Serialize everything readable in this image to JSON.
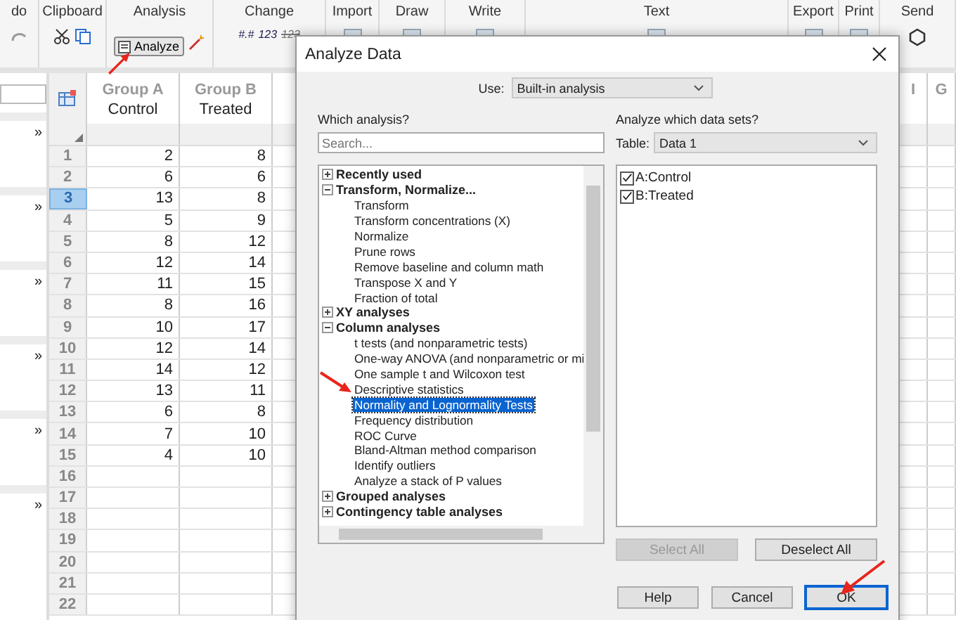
{
  "ribbon": {
    "groups": [
      {
        "label": "do",
        "kind": "undo"
      },
      {
        "label": "Clipboard",
        "kind": "clipboard"
      },
      {
        "label": "Analysis",
        "kind": "analysis"
      },
      {
        "label": "Change",
        "kind": "change"
      },
      {
        "label": "Import",
        "kind": "import"
      },
      {
        "label": "Draw",
        "kind": "draw"
      },
      {
        "label": "Write",
        "kind": "write"
      },
      {
        "label": "Text",
        "kind": "text"
      },
      {
        "label": "Export",
        "kind": "export"
      },
      {
        "label": "Print",
        "kind": "print"
      },
      {
        "label": "Send",
        "kind": "send"
      }
    ],
    "analyze_button": "Analyze",
    "change_glyphs": [
      {
        "text": "#.#",
        "struck": false
      },
      {
        "text": "123",
        "struck": false
      },
      {
        "text": "123",
        "struck": true
      }
    ]
  },
  "navigator": {
    "expanders": [
      "»",
      "»",
      "»",
      "»",
      "»",
      "»"
    ]
  },
  "sheet": {
    "columns": [
      {
        "title": "Group A",
        "subtitle": "Control"
      },
      {
        "title": "Group B",
        "subtitle": "Treated"
      }
    ],
    "far_columns": [
      "I",
      "G"
    ],
    "rows": [
      {
        "number": "1",
        "selected": false,
        "cells": [
          "2",
          "8"
        ]
      },
      {
        "number": "2",
        "selected": false,
        "cells": [
          "6",
          "6"
        ]
      },
      {
        "number": "3",
        "selected": true,
        "cells": [
          "13",
          "8"
        ]
      },
      {
        "number": "4",
        "selected": false,
        "cells": [
          "5",
          "9"
        ]
      },
      {
        "number": "5",
        "selected": false,
        "cells": [
          "8",
          "12"
        ]
      },
      {
        "number": "6",
        "selected": false,
        "cells": [
          "12",
          "14"
        ]
      },
      {
        "number": "7",
        "selected": false,
        "cells": [
          "11",
          "15"
        ]
      },
      {
        "number": "8",
        "selected": false,
        "cells": [
          "8",
          "16"
        ]
      },
      {
        "number": "9",
        "selected": false,
        "cells": [
          "10",
          "17"
        ]
      },
      {
        "number": "10",
        "selected": false,
        "cells": [
          "12",
          "14"
        ]
      },
      {
        "number": "11",
        "selected": false,
        "cells": [
          "14",
          "12"
        ]
      },
      {
        "number": "12",
        "selected": false,
        "cells": [
          "13",
          "11"
        ]
      },
      {
        "number": "13",
        "selected": false,
        "cells": [
          "6",
          "8"
        ]
      },
      {
        "number": "14",
        "selected": false,
        "cells": [
          "7",
          "10"
        ]
      },
      {
        "number": "15",
        "selected": false,
        "cells": [
          "4",
          "10"
        ]
      },
      {
        "number": "16",
        "selected": false,
        "cells": []
      },
      {
        "number": "17",
        "selected": false,
        "cells": []
      },
      {
        "number": "18",
        "selected": false,
        "cells": []
      },
      {
        "number": "19",
        "selected": false,
        "cells": []
      },
      {
        "number": "20",
        "selected": false,
        "cells": []
      },
      {
        "number": "21",
        "selected": false,
        "cells": []
      },
      {
        "number": "22",
        "selected": false,
        "cells": []
      }
    ]
  },
  "dialog": {
    "title": "Analyze Data",
    "use_label": "Use:",
    "use_value": "Built-in analysis",
    "which_label": "Which analysis?",
    "search_placeholder": "Search...",
    "tree": [
      {
        "label": "Recently used",
        "expanded": false
      },
      {
        "label": "Transform, Normalize...",
        "expanded": true,
        "children": [
          {
            "label": "Transform",
            "selected": false
          },
          {
            "label": "Transform concentrations (X)",
            "selected": false
          },
          {
            "label": "Normalize",
            "selected": false
          },
          {
            "label": "Prune rows",
            "selected": false
          },
          {
            "label": "Remove baseline and column math",
            "selected": false
          },
          {
            "label": "Transpose X and Y",
            "selected": false
          },
          {
            "label": "Fraction of total",
            "selected": false
          }
        ]
      },
      {
        "label": "XY analyses",
        "expanded": false
      },
      {
        "label": "Column analyses",
        "expanded": true,
        "children": [
          {
            "label": "t tests (and nonparametric tests)",
            "selected": false
          },
          {
            "label": "One-way ANOVA (and nonparametric or mi",
            "selected": false
          },
          {
            "label": "One sample t and Wilcoxon test",
            "selected": false
          },
          {
            "label": "Descriptive statistics",
            "selected": false
          },
          {
            "label": "Normality and Lognormality Tests",
            "selected": true
          },
          {
            "label": "Frequency distribution",
            "selected": false
          },
          {
            "label": "ROC Curve",
            "selected": false
          },
          {
            "label": "Bland-Altman method comparison",
            "selected": false
          },
          {
            "label": "Identify outliers",
            "selected": false
          },
          {
            "label": "Analyze a stack of P values",
            "selected": false
          }
        ]
      },
      {
        "label": "Grouped analyses",
        "expanded": false
      },
      {
        "label": "Contingency table analyses",
        "expanded": false
      }
    ],
    "datasets_label": "Analyze which data sets?",
    "table_label": "Table:",
    "table_value": "Data 1",
    "datasets": [
      {
        "label": "A:Control",
        "checked": true
      },
      {
        "label": "B:Treated",
        "checked": true
      }
    ],
    "select_all": {
      "label": "Select All",
      "disabled": true
    },
    "deselect_all": {
      "label": "Deselect All",
      "disabled": false
    },
    "buttons": [
      {
        "label": "Help",
        "focused": false
      },
      {
        "label": "Cancel",
        "focused": false
      },
      {
        "label": "OK",
        "focused": true
      }
    ]
  }
}
